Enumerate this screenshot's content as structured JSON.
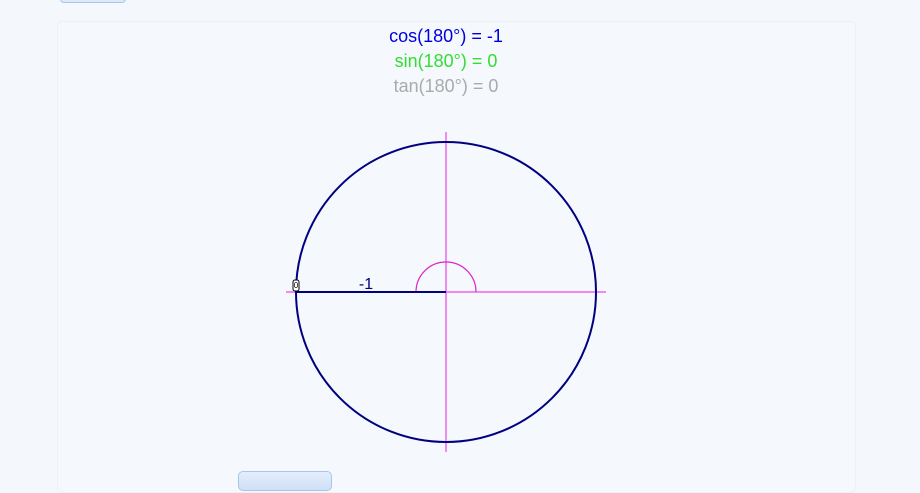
{
  "readouts": {
    "cos": {
      "func": "cos",
      "angle": "180°",
      "value": "-1"
    },
    "sin": {
      "func": "sin",
      "angle": "180°",
      "value": "0"
    },
    "tan": {
      "func": "tan",
      "angle": "180°",
      "value": "0"
    }
  },
  "diagram": {
    "angle_degrees": 180,
    "radius_label": "-1",
    "handle_label": "0"
  },
  "colors": {
    "cos": "#0000dd",
    "sin": "#33dd33",
    "tan": "#aaaaaa",
    "circle": "#000080",
    "axes": "#ee66ee",
    "arc": "#dd22cc",
    "radius_label": "#000080"
  }
}
